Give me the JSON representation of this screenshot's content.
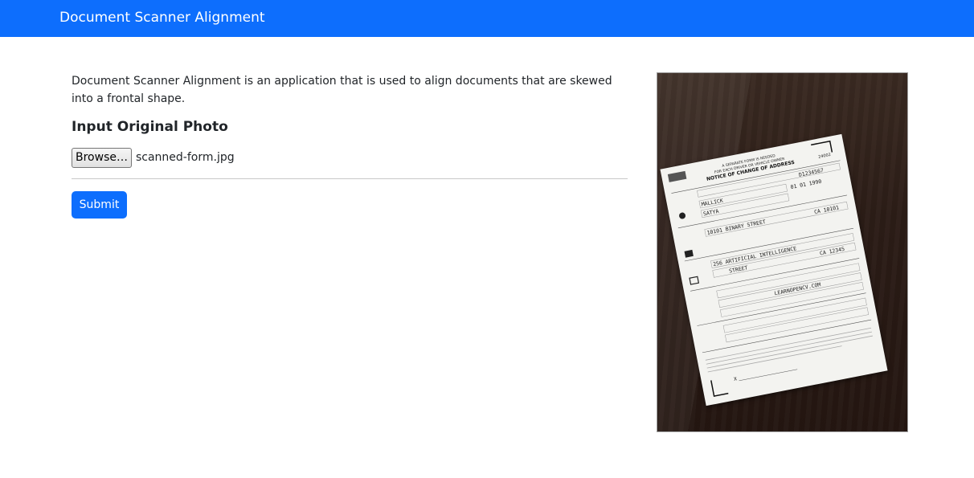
{
  "navbar": {
    "brand": "Document Scanner Alignment"
  },
  "main": {
    "description": "Document Scanner Alignment is an application that is used to align documents that are skewed into a frontal shape.",
    "section_title": "Input Original Photo",
    "file_input": {
      "button_label": "Browse…",
      "file_name": "scanned-form.jpg"
    },
    "submit_label": "Submit"
  },
  "preview": {
    "form": {
      "header_line1": "A SEPARATE FORM IS NEEDED",
      "header_line2": "FOR EACH DRIVER OR VEHICLE OWNER",
      "title": "NOTICE OF CHANGE OF ADDRESS",
      "form_code": "24002",
      "id_number": "D1234567",
      "last_name": "MALLICK",
      "birth_date": "01 01 1990",
      "first_name": "SATYA",
      "street_address": "10101 BINARY STREET",
      "state_zip": "CA 10101",
      "mailing_street_1": "256 ARTIFICIAL INTELLIGENCE",
      "mailing_street_2": "STREET",
      "mailing_state_zip": "CA 12345",
      "vehicle_text": "LEARNOPENCV.COM",
      "signature_mark": "X"
    }
  },
  "colors": {
    "primary": "#0d6efd",
    "text": "#212529"
  }
}
